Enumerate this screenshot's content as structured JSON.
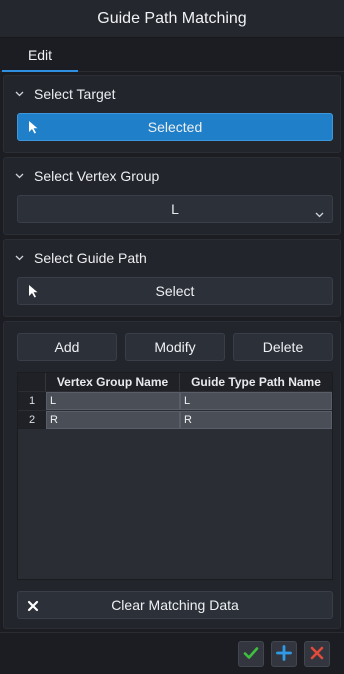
{
  "window": {
    "title": "Guide Path Matching"
  },
  "tabs": [
    {
      "label": "Edit"
    }
  ],
  "select_target": {
    "header": "Select Target",
    "button_label": "Selected"
  },
  "select_vertex_group": {
    "header": "Select Vertex Group",
    "value": "L"
  },
  "select_guide_path": {
    "header": "Select Guide Path",
    "button_label": "Select"
  },
  "matching": {
    "add_label": "Add",
    "modify_label": "Modify",
    "delete_label": "Delete",
    "columns": [
      "Vertex Group Name",
      "Guide Type Path Name"
    ],
    "rows": [
      {
        "num": "1",
        "vertex_group": "L",
        "guide_path": "L"
      },
      {
        "num": "2",
        "vertex_group": "R",
        "guide_path": "R"
      }
    ],
    "clear_label": "Clear Matching Data"
  },
  "footer": {
    "confirm_icon": "check-icon",
    "add_icon": "plus-icon",
    "cancel_icon": "close-icon"
  },
  "colors": {
    "accent": "#1f7fc9",
    "confirm": "#3fbf3f",
    "add": "#2f9be8",
    "cancel": "#e04b3a"
  }
}
